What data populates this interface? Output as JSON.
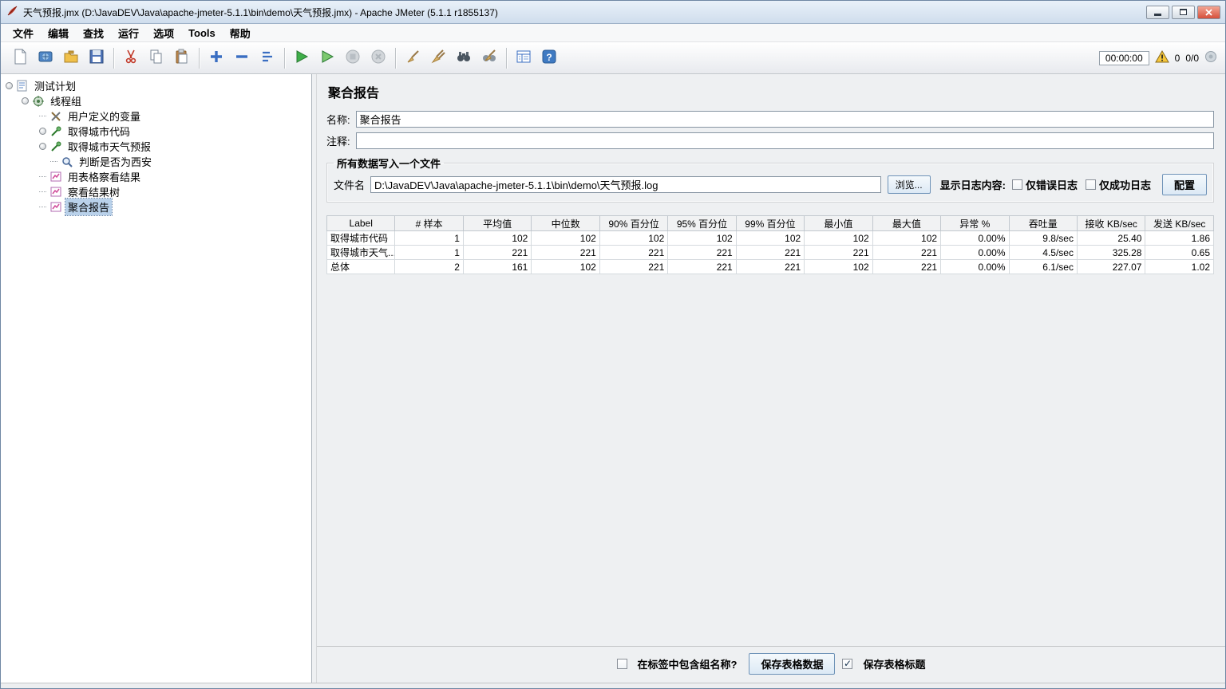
{
  "window": {
    "title": "天气预报.jmx (D:\\JavaDEV\\Java\\apache-jmeter-5.1.1\\bin\\demo\\天气预报.jmx) - Apache JMeter (5.1.1 r1855137)"
  },
  "menu": {
    "items": [
      {
        "label": "文件"
      },
      {
        "label": "编辑"
      },
      {
        "label": "查找"
      },
      {
        "label": "运行"
      },
      {
        "label": "选项"
      },
      {
        "label": "Tools"
      },
      {
        "label": "帮助"
      }
    ]
  },
  "toolbar": {
    "timer": "00:00:00",
    "warning_count": "0",
    "thread_status": "0/0",
    "icons": [
      "new-file-icon",
      "templates-icon",
      "open-file-icon",
      "save-icon",
      "cut-icon",
      "copy-icon",
      "paste-icon",
      "expand-all-icon",
      "collapse-all-icon",
      "toggle-icon",
      "start-icon",
      "start-no-timers-icon",
      "stop-icon",
      "shutdown-icon",
      "clear-icon",
      "clear-all-icon",
      "search-icon",
      "search-reset-icon",
      "function-helper-icon",
      "help-icon",
      "warning-icon",
      "test-running-indicator-icon"
    ]
  },
  "tree": {
    "items": [
      {
        "label": "测试计划",
        "level": 0,
        "icon": "test-plan-icon",
        "expandable": true,
        "selected": false
      },
      {
        "label": "线程组",
        "level": 1,
        "icon": "thread-group-icon",
        "expandable": true,
        "selected": false
      },
      {
        "label": "用户定义的变量",
        "level": 2,
        "icon": "user-variables-icon",
        "expandable": false,
        "selected": false
      },
      {
        "label": "取得城市代码",
        "level": 2,
        "icon": "http-sampler-icon",
        "expandable": true,
        "selected": false
      },
      {
        "label": "取得城市天气预报",
        "level": 2,
        "icon": "http-sampler-icon",
        "expandable": true,
        "selected": false
      },
      {
        "label": "判断是否为西安",
        "level": 3,
        "icon": "assertion-icon",
        "expandable": false,
        "selected": false
      },
      {
        "label": "用表格察看结果",
        "level": 2,
        "icon": "listener-icon",
        "expandable": false,
        "selected": false
      },
      {
        "label": "察看结果树",
        "level": 2,
        "icon": "listener-icon",
        "expandable": false,
        "selected": false
      },
      {
        "label": "聚合报告",
        "level": 2,
        "icon": "listener-icon",
        "expandable": false,
        "selected": true
      }
    ]
  },
  "panel": {
    "title": "聚合报告",
    "name_label": "名称:",
    "name_value": "聚合报告",
    "comments_label": "注释:",
    "comments_value": "",
    "file_group": {
      "title": "所有数据写入一个文件",
      "filename_label": "文件名",
      "filename_value": "D:\\JavaDEV\\Java\\apache-jmeter-5.1.1\\bin\\demo\\天气预报.log",
      "browse_button": "浏览...",
      "log_label": "显示日志内容:",
      "errors_only_label": "仅错误日志",
      "errors_only_checked": false,
      "success_only_label": "仅成功日志",
      "success_only_checked": false,
      "configure_button": "配置"
    },
    "table": {
      "columns": [
        "Label",
        "# 样本",
        "平均值",
        "中位数",
        "90% 百分位",
        "95% 百分位",
        "99% 百分位",
        "最小值",
        "最大值",
        "异常 %",
        "吞吐量",
        "接收 KB/sec",
        "发送 KB/sec"
      ],
      "rows": [
        [
          "取得城市代码",
          "1",
          "102",
          "102",
          "102",
          "102",
          "102",
          "102",
          "102",
          "0.00%",
          "9.8/sec",
          "25.40",
          "1.86"
        ],
        [
          "取得城市天气...",
          "1",
          "221",
          "221",
          "221",
          "221",
          "221",
          "221",
          "221",
          "0.00%",
          "4.5/sec",
          "325.28",
          "0.65"
        ],
        [
          "总体",
          "2",
          "161",
          "102",
          "221",
          "221",
          "221",
          "102",
          "221",
          "0.00%",
          "6.1/sec",
          "227.07",
          "1.02"
        ]
      ]
    },
    "footer": {
      "include_group_label": "在标签中包含组名称?",
      "include_group_checked": false,
      "save_table_button": "保存表格数据",
      "save_header_label": "保存表格标题",
      "save_header_checked": true
    }
  },
  "colors": {
    "selection": "#b9d1ea",
    "start_green": "#3fae49",
    "titlebar": "#d9e4f0",
    "close_red": "#d6503c"
  }
}
